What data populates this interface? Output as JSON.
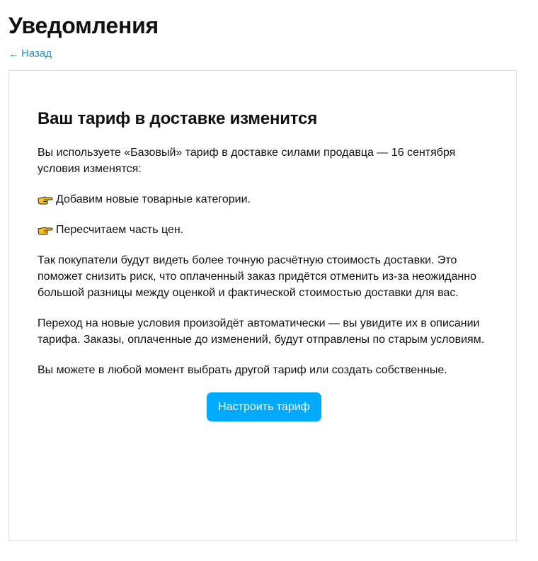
{
  "header": {
    "title": "Уведомления",
    "back_arrow": "←",
    "back_label": "Назад"
  },
  "card": {
    "title": "Ваш тариф в доставке изменится",
    "intro": "Вы используете «Базовый» тариф в доставке силами продавца — 16 сентября условия изменятся:",
    "bullets": [
      "Добавим новые товарные категории.",
      "Пересчитаем часть цен."
    ],
    "bullet_icon": "pointing-hand-icon",
    "paragraph_1": "Так покупатели будут видеть более точную расчётную стоимость доставки. Это поможет снизить риск, что оплаченный заказ придётся отменить из-за неожиданно большой разницы между оценкой и фактической стоимостью доставки для вас.",
    "paragraph_2": "Переход на новые условия произойдёт автоматически — вы увидите их в описании тарифа. Заказы, оплаченные до изменений, будут отправлены по старым условиям.",
    "paragraph_3": "Вы можете в любой момент выбрать другой тариф или создать собственные.",
    "button_label": "Настроить тариф"
  },
  "colors": {
    "link": "#1a8fd6",
    "button": "#00aaff",
    "border": "#dedede"
  }
}
